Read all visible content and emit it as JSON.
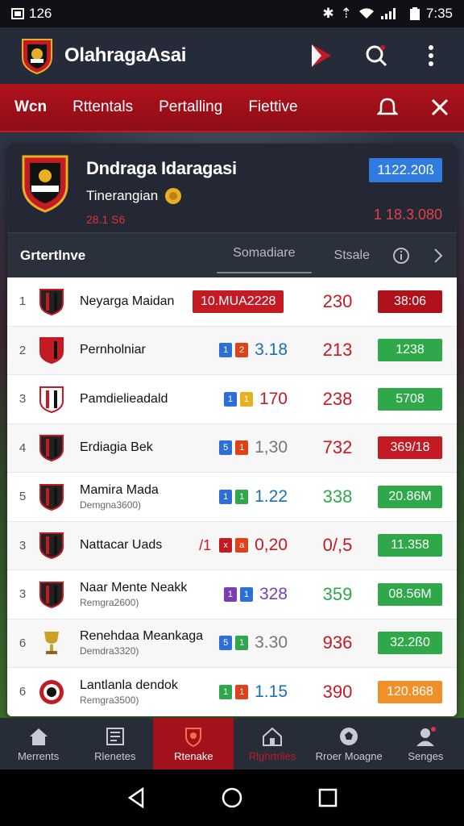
{
  "status": {
    "left": "126",
    "time": "7:35"
  },
  "app": {
    "title": "OlahragaAsai"
  },
  "tabs": [
    {
      "label": "Wcn",
      "active": true
    },
    {
      "label": "Rttentals"
    },
    {
      "label": "Pertalling"
    },
    {
      "label": "Fiettive"
    }
  ],
  "team": {
    "name": "Dndraga Idaragasi",
    "subtitle": "Tinerangian",
    "date": "28.1 S6",
    "badge": "1122.20ß",
    "price": "1 18.3.080"
  },
  "filter": {
    "title": "Grtertlnve",
    "tabs": [
      "Somadiare",
      "Stsale"
    ]
  },
  "rows": [
    {
      "rank": "1",
      "name": "Neyarga Maidan",
      "sub": "",
      "pill": "10.MUA2228",
      "odds": "",
      "points": "230",
      "points_color": "#c41a24",
      "value": "38:06",
      "value_color": "#b0121c",
      "crest": "black"
    },
    {
      "rank": "2",
      "name": "Pernholniar",
      "sub": "",
      "chips": [
        "#2d6fd6",
        "#e0401a"
      ],
      "chip_labels": [
        "1",
        "2"
      ],
      "odds": "3.18",
      "odds_color": "#1a6fb8",
      "points": "213",
      "points_color": "#c41a24",
      "value": "1238",
      "value_color": "#2fa84a",
      "crest": "red"
    },
    {
      "rank": "3",
      "name": "Pamdielieadald",
      "sub": "",
      "chips": [
        "#2d6fd6",
        "#e8b020"
      ],
      "chip_labels": [
        "1",
        "1"
      ],
      "odds": "170",
      "odds_color": "#c41a24",
      "points": "238",
      "points_color": "#c41a24",
      "value": "5708",
      "value_color": "#2fa84a",
      "crest": "white"
    },
    {
      "rank": "4",
      "name": "Erdiagia Bek",
      "sub": "",
      "chips": [
        "#2d6fd6",
        "#e0401a"
      ],
      "chip_labels": [
        "5",
        "1"
      ],
      "odds": "1,30",
      "odds_color": "#777",
      "points": "732",
      "points_color": "#c41a24",
      "value": "369/18",
      "value_color": "#c41a24",
      "crest": "stripe"
    },
    {
      "rank": "5",
      "name": "Mamira Mada",
      "sub": "Demgna3600)",
      "chips": [
        "#2d6fd6",
        "#2fa84a"
      ],
      "chip_labels": [
        "1",
        "1"
      ],
      "odds": "1.22",
      "odds_color": "#1a6fb8",
      "points": "338",
      "points_color": "#2fa84a",
      "value": "20.86M",
      "value_color": "#2fa84a",
      "crest": "stripe"
    },
    {
      "rank": "3",
      "name": "Nattacar Uads",
      "sub": "",
      "chips": [
        "#c41a24",
        "#e0401a"
      ],
      "chip_labels": [
        "x",
        "a"
      ],
      "odds": "0,20",
      "odds_color": "#c41a24",
      "points": "0/,5",
      "points_color": "#c41a24",
      "value": "11.358",
      "value_color": "#2fa84a",
      "crest": "stripe",
      "flag": "/1"
    },
    {
      "rank": "3",
      "name": "Naar Mente Neakk",
      "sub": "Remgra2600)",
      "chips": [
        "#7b3fb0",
        "#2d6fd6"
      ],
      "chip_labels": [
        "1",
        "1"
      ],
      "odds": "328",
      "odds_color": "#7b3fb0",
      "points": "359",
      "points_color": "#2fa84a",
      "value": "08.56M",
      "value_color": "#2fa84a",
      "crest": "stripe"
    },
    {
      "rank": "6",
      "name": "Renehdaa Meankaga",
      "sub": "Demdra3320)",
      "chips": [
        "#2d6fd6",
        "#2fa84a"
      ],
      "chip_labels": [
        "5",
        "1"
      ],
      "odds": "3.30",
      "odds_color": "#777",
      "points": "936",
      "points_color": "#c41a24",
      "value": "32.2ß0",
      "value_color": "#2fa84a",
      "crest": "cup"
    },
    {
      "rank": "6",
      "name": "Lantlanla dendok",
      "sub": "Remgra3500)",
      "chips": [
        "#2fa84a",
        "#e0401a"
      ],
      "chip_labels": [
        "1",
        "1"
      ],
      "odds": "1.15",
      "odds_color": "#1a6fb8",
      "points": "390",
      "points_color": "#c41a24",
      "value": "120.868",
      "value_color": "#f0902a",
      "crest": "round"
    }
  ],
  "nav": [
    {
      "label": "Merrents",
      "icon": "home-icon"
    },
    {
      "label": "Rlenetes",
      "icon": "news-icon"
    },
    {
      "label": "Rtenake",
      "icon": "shield-icon",
      "active": true
    },
    {
      "label": "Rlghrtrlles",
      "icon": "house-icon"
    },
    {
      "label": "Rroer Moagne",
      "icon": "soccer-icon"
    },
    {
      "label": "Senges",
      "icon": "profile-icon"
    }
  ]
}
